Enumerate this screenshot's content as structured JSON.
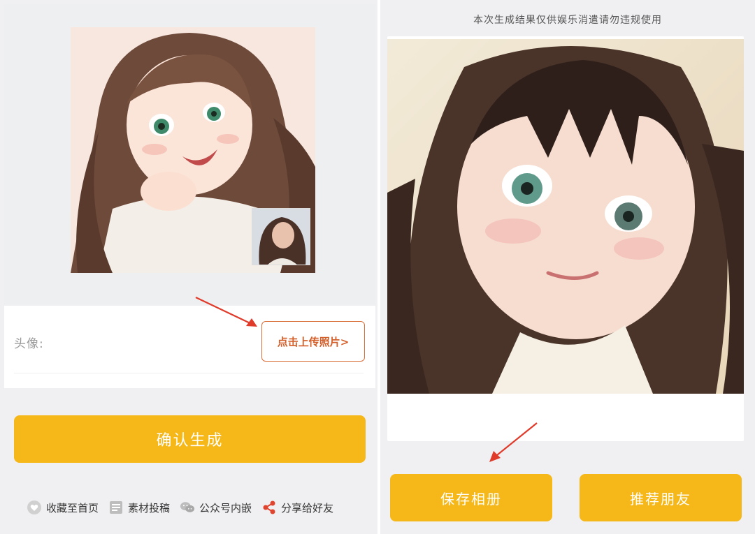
{
  "left": {
    "preview": {
      "icon": "anime-portrait-preview"
    },
    "thumbnail": {
      "icon": "original-photo-thumbnail"
    },
    "form": {
      "avatar_label": "头像:",
      "upload_button": "点击上传照片>"
    },
    "confirm_button": "确认生成",
    "footer": [
      {
        "label": "收藏至首页",
        "icon": "heart-icon"
      },
      {
        "label": "素材投稿",
        "icon": "document-icon"
      },
      {
        "label": "公众号内嵌",
        "icon": "wechat-icon"
      },
      {
        "label": "分享给好友",
        "icon": "share-icon"
      }
    ]
  },
  "right": {
    "notice": "本次生成结果仅供娱乐消遣请勿违规使用",
    "result": {
      "icon": "generated-anime-portrait"
    },
    "save_button": "保存相册",
    "share_button": "推荐朋友"
  },
  "colors": {
    "accent": "#f6b718",
    "upload_border": "#d9703a",
    "arrow": "#e03a2a",
    "background": "#f0f0f2"
  }
}
